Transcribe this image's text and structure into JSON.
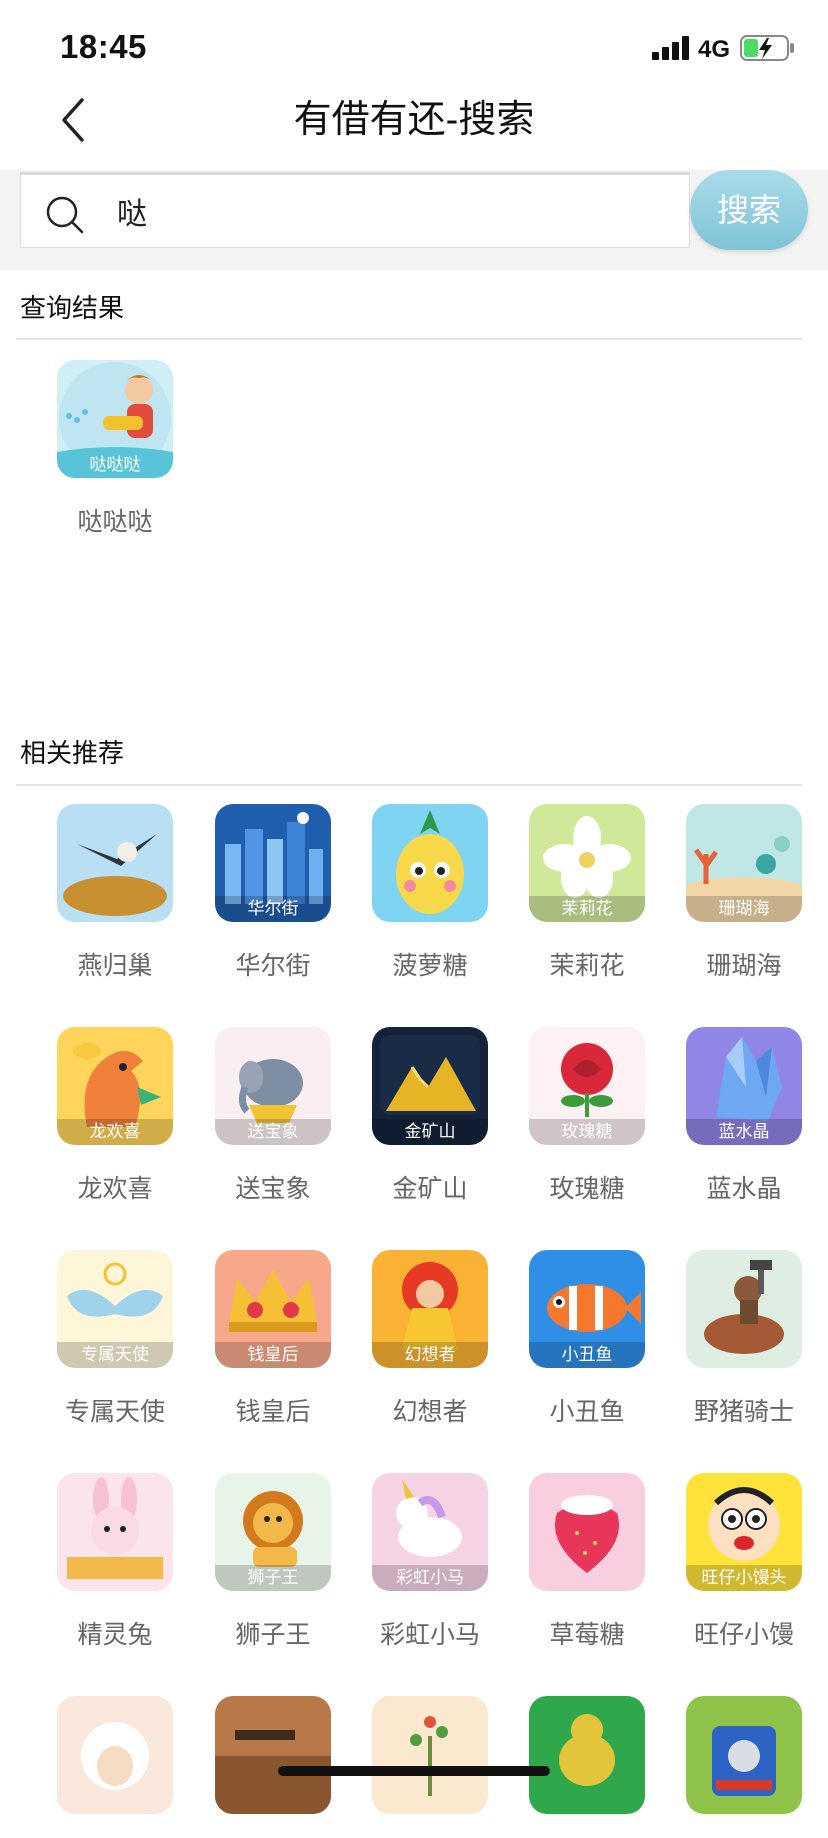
{
  "status_bar": {
    "time": "18:45",
    "network": "4G"
  },
  "nav": {
    "title": "有借有还-搜索"
  },
  "search": {
    "value": "哒",
    "button_label": "搜索"
  },
  "results": {
    "section_title": "查询结果",
    "items": [
      {
        "label": "哒哒哒",
        "icon": "water-gun-boy-icon",
        "caption": "哒哒哒",
        "bg": "#cfeef5"
      }
    ]
  },
  "recommend": {
    "section_title": "相关推荐",
    "items": [
      {
        "label": "燕归巢",
        "icon": "swallow-nest-icon",
        "caption": "",
        "bg": "#b8dff4"
      },
      {
        "label": "华尔街",
        "icon": "city-skyline-icon",
        "caption": "华尔街",
        "bg": "#1f5fae"
      },
      {
        "label": "菠萝糖",
        "icon": "pineapple-icon",
        "caption": "",
        "bg": "#7fd4f2"
      },
      {
        "label": "茉莉花",
        "icon": "jasmine-icon",
        "caption": "茉莉花",
        "bg": "#cfe89a"
      },
      {
        "label": "珊瑚海",
        "icon": "coral-sea-icon",
        "caption": "珊瑚海",
        "bg": "#bfe7e6"
      },
      {
        "label": "龙欢喜",
        "icon": "dragon-icon",
        "caption": "龙欢喜",
        "bg": "#ffd45a"
      },
      {
        "label": "送宝象",
        "icon": "elephant-icon",
        "caption": "送宝象",
        "bg": "#fbeef0"
      },
      {
        "label": "金矿山",
        "icon": "gold-mountain-icon",
        "caption": "金矿山",
        "bg": "#14233a"
      },
      {
        "label": "玫瑰糖",
        "icon": "rose-icon",
        "caption": "玫瑰糖",
        "bg": "#fdf1f4"
      },
      {
        "label": "蓝水晶",
        "icon": "blue-crystal-icon",
        "caption": "蓝水晶",
        "bg": "#8f86e6"
      },
      {
        "label": "专属天使",
        "icon": "angel-wings-icon",
        "caption": "专属天使",
        "bg": "#fdf6d8"
      },
      {
        "label": "钱皇后",
        "icon": "crown-icon",
        "caption": "钱皇后",
        "bg": "#f7a88a"
      },
      {
        "label": "幻想者",
        "icon": "fantasy-girl-icon",
        "caption": "幻想者",
        "bg": "#f9b233"
      },
      {
        "label": "小丑鱼",
        "icon": "clownfish-icon",
        "caption": "小丑鱼",
        "bg": "#2f8fe6"
      },
      {
        "label": "野猪骑士",
        "icon": "boar-rider-icon",
        "caption": "",
        "bg": "#dfeee3"
      },
      {
        "label": "精灵兔",
        "icon": "bunny-icon",
        "caption": "",
        "bg": "#fbe4ea"
      },
      {
        "label": "狮子王",
        "icon": "lion-icon",
        "caption": "狮子王",
        "bg": "#e9f4e9"
      },
      {
        "label": "彩虹小马",
        "icon": "unicorn-icon",
        "caption": "彩虹小马",
        "bg": "#f7d3e6"
      },
      {
        "label": "草莓糖",
        "icon": "strawberry-icon",
        "caption": "",
        "bg": "#f9cfe0"
      },
      {
        "label": "旺仔小馒",
        "icon": "wangzai-icon",
        "caption": "旺仔小馒头",
        "bg": "#ffe23a"
      },
      {
        "label": "",
        "icon": "sheep-icon",
        "caption": "",
        "bg": "#fbe8dc"
      },
      {
        "label": "",
        "icon": "soldier-icon",
        "caption": "",
        "bg": "#b97847"
      },
      {
        "label": "",
        "icon": "plant-icon",
        "caption": "",
        "bg": "#fbe9cf"
      },
      {
        "label": "",
        "icon": "dinosaur-icon",
        "caption": "",
        "bg": "#2ea84a"
      },
      {
        "label": "",
        "icon": "train-icon",
        "caption": "",
        "bg": "#8fc34a"
      }
    ]
  }
}
